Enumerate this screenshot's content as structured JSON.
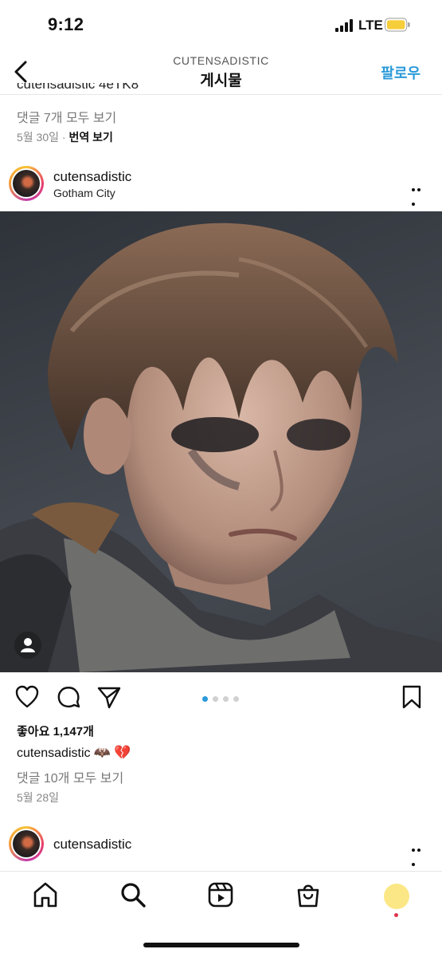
{
  "status": {
    "time": "9:12",
    "network": "LTE"
  },
  "nav": {
    "account": "CUTENSADISTIC",
    "title": "게시물",
    "follow_label": "팔로우"
  },
  "prev_post": {
    "caption_clipped": "cutensadistic 4eTK8",
    "comments_link": "댓글 7개 모두 보기",
    "date": "5월 30일",
    "translate": "번역 보기"
  },
  "post": {
    "username": "cutensadistic",
    "location": "Gotham City",
    "likes": "좋아요 1,147개",
    "caption_user": "cutensadistic",
    "caption_emoji": "🦇 💔",
    "comments_link": "댓글 10개 모두 보기",
    "date": "5월 28일",
    "carousel": {
      "count": 4,
      "active": 0
    }
  },
  "next_post": {
    "username": "cutensadistic"
  },
  "colors": {
    "accent": "#2b9ad9",
    "story_ring": [
      "#f9c234",
      "#e83f6b",
      "#c23aa9"
    ]
  },
  "tabbar": {
    "items": [
      "home-icon",
      "search-icon",
      "reels-icon",
      "shop-icon",
      "profile-avatar"
    ]
  }
}
